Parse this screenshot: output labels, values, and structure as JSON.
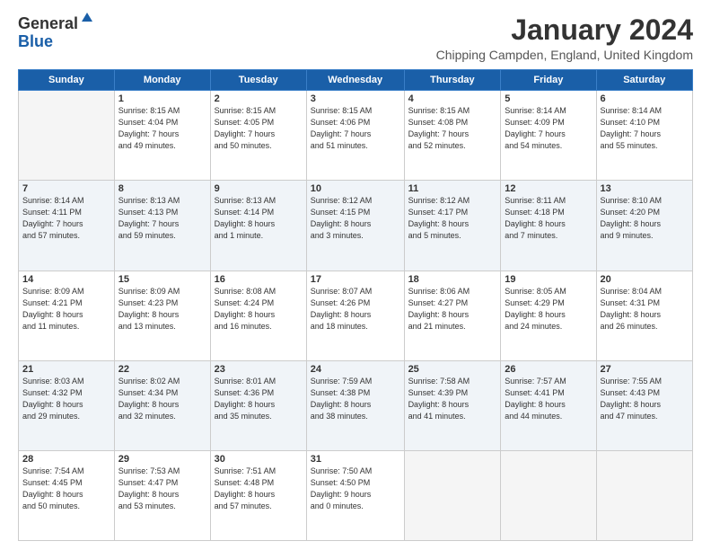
{
  "header": {
    "logo_general": "General",
    "logo_blue": "Blue",
    "title": "January 2024",
    "location": "Chipping Campden, England, United Kingdom"
  },
  "calendar": {
    "days_of_week": [
      "Sunday",
      "Monday",
      "Tuesday",
      "Wednesday",
      "Thursday",
      "Friday",
      "Saturday"
    ],
    "weeks": [
      [
        {
          "day": "",
          "info": ""
        },
        {
          "day": "1",
          "info": "Sunrise: 8:15 AM\nSunset: 4:04 PM\nDaylight: 7 hours\nand 49 minutes."
        },
        {
          "day": "2",
          "info": "Sunrise: 8:15 AM\nSunset: 4:05 PM\nDaylight: 7 hours\nand 50 minutes."
        },
        {
          "day": "3",
          "info": "Sunrise: 8:15 AM\nSunset: 4:06 PM\nDaylight: 7 hours\nand 51 minutes."
        },
        {
          "day": "4",
          "info": "Sunrise: 8:15 AM\nSunset: 4:08 PM\nDaylight: 7 hours\nand 52 minutes."
        },
        {
          "day": "5",
          "info": "Sunrise: 8:14 AM\nSunset: 4:09 PM\nDaylight: 7 hours\nand 54 minutes."
        },
        {
          "day": "6",
          "info": "Sunrise: 8:14 AM\nSunset: 4:10 PM\nDaylight: 7 hours\nand 55 minutes."
        }
      ],
      [
        {
          "day": "7",
          "info": "Sunrise: 8:14 AM\nSunset: 4:11 PM\nDaylight: 7 hours\nand 57 minutes."
        },
        {
          "day": "8",
          "info": "Sunrise: 8:13 AM\nSunset: 4:13 PM\nDaylight: 7 hours\nand 59 minutes."
        },
        {
          "day": "9",
          "info": "Sunrise: 8:13 AM\nSunset: 4:14 PM\nDaylight: 8 hours\nand 1 minute."
        },
        {
          "day": "10",
          "info": "Sunrise: 8:12 AM\nSunset: 4:15 PM\nDaylight: 8 hours\nand 3 minutes."
        },
        {
          "day": "11",
          "info": "Sunrise: 8:12 AM\nSunset: 4:17 PM\nDaylight: 8 hours\nand 5 minutes."
        },
        {
          "day": "12",
          "info": "Sunrise: 8:11 AM\nSunset: 4:18 PM\nDaylight: 8 hours\nand 7 minutes."
        },
        {
          "day": "13",
          "info": "Sunrise: 8:10 AM\nSunset: 4:20 PM\nDaylight: 8 hours\nand 9 minutes."
        }
      ],
      [
        {
          "day": "14",
          "info": "Sunrise: 8:09 AM\nSunset: 4:21 PM\nDaylight: 8 hours\nand 11 minutes."
        },
        {
          "day": "15",
          "info": "Sunrise: 8:09 AM\nSunset: 4:23 PM\nDaylight: 8 hours\nand 13 minutes."
        },
        {
          "day": "16",
          "info": "Sunrise: 8:08 AM\nSunset: 4:24 PM\nDaylight: 8 hours\nand 16 minutes."
        },
        {
          "day": "17",
          "info": "Sunrise: 8:07 AM\nSunset: 4:26 PM\nDaylight: 8 hours\nand 18 minutes."
        },
        {
          "day": "18",
          "info": "Sunrise: 8:06 AM\nSunset: 4:27 PM\nDaylight: 8 hours\nand 21 minutes."
        },
        {
          "day": "19",
          "info": "Sunrise: 8:05 AM\nSunset: 4:29 PM\nDaylight: 8 hours\nand 24 minutes."
        },
        {
          "day": "20",
          "info": "Sunrise: 8:04 AM\nSunset: 4:31 PM\nDaylight: 8 hours\nand 26 minutes."
        }
      ],
      [
        {
          "day": "21",
          "info": "Sunrise: 8:03 AM\nSunset: 4:32 PM\nDaylight: 8 hours\nand 29 minutes."
        },
        {
          "day": "22",
          "info": "Sunrise: 8:02 AM\nSunset: 4:34 PM\nDaylight: 8 hours\nand 32 minutes."
        },
        {
          "day": "23",
          "info": "Sunrise: 8:01 AM\nSunset: 4:36 PM\nDaylight: 8 hours\nand 35 minutes."
        },
        {
          "day": "24",
          "info": "Sunrise: 7:59 AM\nSunset: 4:38 PM\nDaylight: 8 hours\nand 38 minutes."
        },
        {
          "day": "25",
          "info": "Sunrise: 7:58 AM\nSunset: 4:39 PM\nDaylight: 8 hours\nand 41 minutes."
        },
        {
          "day": "26",
          "info": "Sunrise: 7:57 AM\nSunset: 4:41 PM\nDaylight: 8 hours\nand 44 minutes."
        },
        {
          "day": "27",
          "info": "Sunrise: 7:55 AM\nSunset: 4:43 PM\nDaylight: 8 hours\nand 47 minutes."
        }
      ],
      [
        {
          "day": "28",
          "info": "Sunrise: 7:54 AM\nSunset: 4:45 PM\nDaylight: 8 hours\nand 50 minutes."
        },
        {
          "day": "29",
          "info": "Sunrise: 7:53 AM\nSunset: 4:47 PM\nDaylight: 8 hours\nand 53 minutes."
        },
        {
          "day": "30",
          "info": "Sunrise: 7:51 AM\nSunset: 4:48 PM\nDaylight: 8 hours\nand 57 minutes."
        },
        {
          "day": "31",
          "info": "Sunrise: 7:50 AM\nSunset: 4:50 PM\nDaylight: 9 hours\nand 0 minutes."
        },
        {
          "day": "",
          "info": ""
        },
        {
          "day": "",
          "info": ""
        },
        {
          "day": "",
          "info": ""
        }
      ]
    ]
  }
}
